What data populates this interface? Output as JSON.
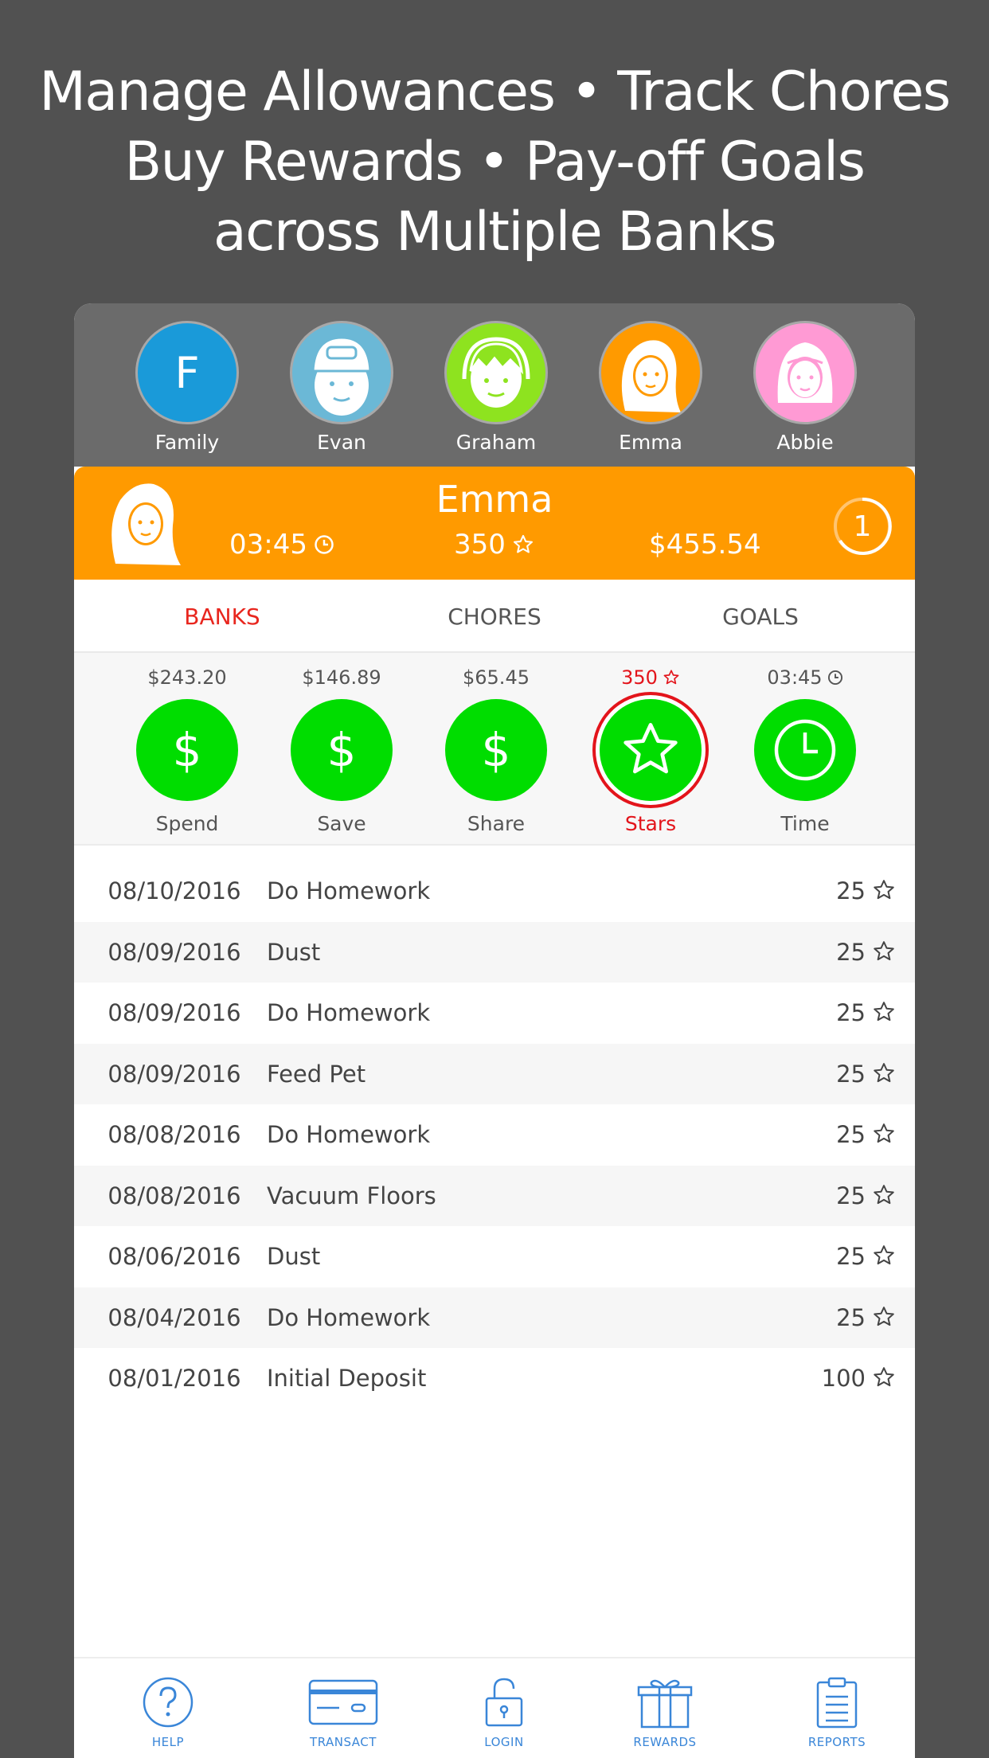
{
  "headline": {
    "line1": "Manage Allowances • Track Chores",
    "line2": "Buy Rewards • Pay-off Goals",
    "line3": "across Multiple Banks"
  },
  "kids": [
    {
      "name": "Family",
      "letter": "F",
      "color": "#1a9ad9"
    },
    {
      "name": "Evan",
      "color": "#6bb8d6"
    },
    {
      "name": "Graham",
      "color": "#8ee31f"
    },
    {
      "name": "Emma",
      "color": "#ff9a00"
    },
    {
      "name": "Abbie",
      "color": "#ff9ad4"
    }
  ],
  "profile": {
    "name": "Emma",
    "time": "03:45",
    "stars": "350",
    "money": "$455.54",
    "badge": "1"
  },
  "tabs": [
    "BANKS",
    "CHORES",
    "GOALS"
  ],
  "banks": [
    {
      "amount": "$243.20",
      "label": "Spend",
      "icon": "dollar-icon"
    },
    {
      "amount": "$146.89",
      "label": "Save",
      "icon": "dollar-icon"
    },
    {
      "amount": "$65.45",
      "label": "Share",
      "icon": "dollar-icon"
    },
    {
      "amount": "350",
      "label": "Stars",
      "icon": "star-icon"
    },
    {
      "amount": "03:45",
      "label": "Time",
      "icon": "clock-icon"
    }
  ],
  "transactions": [
    {
      "date": "08/10/2016",
      "desc": "Do Homework",
      "pts": "25"
    },
    {
      "date": "08/09/2016",
      "desc": "Dust",
      "pts": "25"
    },
    {
      "date": "08/09/2016",
      "desc": "Do Homework",
      "pts": "25"
    },
    {
      "date": "08/09/2016",
      "desc": "Feed Pet",
      "pts": "25"
    },
    {
      "date": "08/08/2016",
      "desc": "Do Homework",
      "pts": "25"
    },
    {
      "date": "08/08/2016",
      "desc": "Vacuum Floors",
      "pts": "25"
    },
    {
      "date": "08/06/2016",
      "desc": "Dust",
      "pts": "25"
    },
    {
      "date": "08/04/2016",
      "desc": "Do Homework",
      "pts": "25"
    },
    {
      "date": "08/01/2016",
      "desc": "Initial Deposit",
      "pts": "100"
    }
  ],
  "nav": [
    {
      "label": "HELP",
      "icon": "help-icon"
    },
    {
      "label": "TRANSACT",
      "icon": "card-icon"
    },
    {
      "label": "LOGIN",
      "icon": "lock-icon"
    },
    {
      "label": "REWARDS",
      "icon": "gift-icon"
    },
    {
      "label": "REPORTS",
      "icon": "clipboard-icon"
    }
  ],
  "colors": {
    "background": "#515151",
    "avatar_bar": "#6b6b6b",
    "profile_bar": "#ff9a00",
    "accent_red": "#e8261e",
    "bank_green": "#00dd00",
    "nav_blue": "#3a86d8"
  }
}
